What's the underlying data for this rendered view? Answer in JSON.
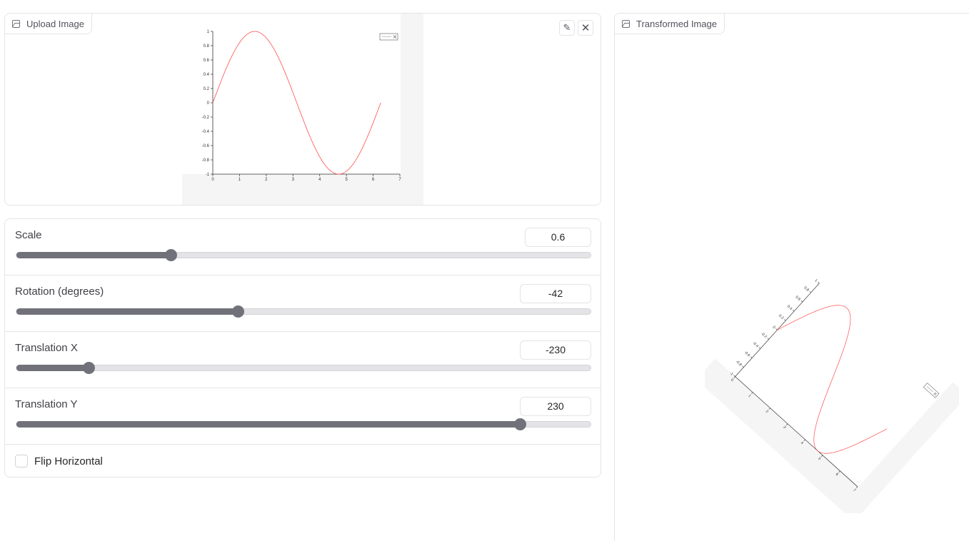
{
  "upload": {
    "label": "Upload Image",
    "label_icon": "image-icon",
    "edit_icon": "pencil-icon",
    "clear_icon": "close-icon",
    "edit_glyph": "✎",
    "clear_glyph": "✕"
  },
  "controls": {
    "scale": {
      "label": "Scale",
      "value": "0.6",
      "fraction": 0.268
    },
    "rotation": {
      "label": "Rotation (degrees)",
      "value": "-42",
      "fraction": 0.385
    },
    "translation_x": {
      "label": "Translation X",
      "value": "-230",
      "fraction": 0.125
    },
    "translation_y": {
      "label": "Translation Y",
      "value": "230",
      "fraction": 0.875
    },
    "flip": {
      "label": "Flip Horizontal",
      "checked": false
    }
  },
  "output": {
    "label": "Transformed Image",
    "label_icon": "image-icon"
  },
  "chart_data": {
    "type": "line",
    "title": "",
    "xlabel": "",
    "ylabel": "",
    "xlim": [
      0,
      7
    ],
    "ylim": [
      -1,
      1
    ],
    "x_ticks": [
      "0",
      "1",
      "2",
      "3",
      "4",
      "5",
      "6",
      "7"
    ],
    "y_ticks": [
      "1",
      "0.8",
      "0.6",
      "0.4",
      "0.2",
      "0",
      "-0.2",
      "-0.4",
      "-0.6",
      "-0.8",
      "-1"
    ],
    "series": [
      {
        "function": "sin(x)",
        "x_range": [
          0,
          6.283
        ],
        "color": "#ff4d4d"
      }
    ],
    "grid": false,
    "legend": "top-right"
  }
}
